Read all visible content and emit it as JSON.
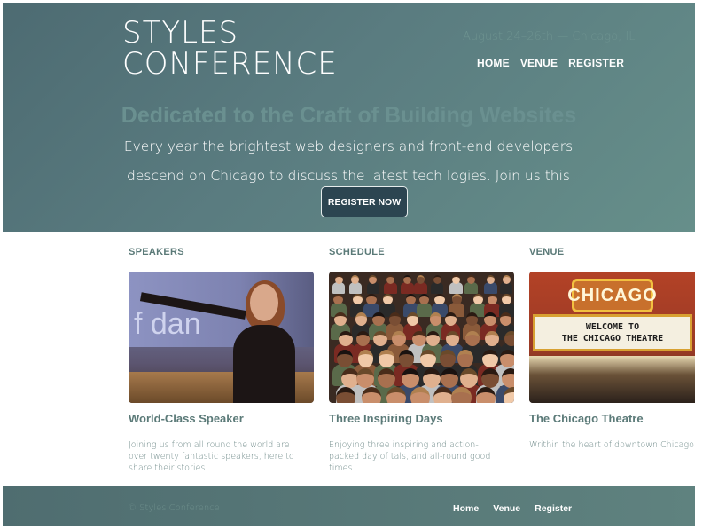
{
  "header": {
    "logo_line1": "STYLES",
    "logo_line2": "CONFERENCE",
    "tagline": "August 24–26th — Chicago, IL",
    "nav": [
      "HOME",
      "VENUE",
      "REGISTER"
    ]
  },
  "hero": {
    "headline": "Dedicated to the Craft of Building Websites",
    "lead": "Every year the brightest web designers and front-end developers descend on Chicago to discuss the latest tech logies. Join us this August!",
    "button": "REGISTER NOW"
  },
  "columns": [
    {
      "section": "SPEAKERS",
      "title": "World-Class Speaker",
      "text": "Joining us from all round the world are over twenty fantastic speakers, here to share their stories.",
      "image_text": "f dan"
    },
    {
      "section": "SCHEDULE",
      "title": "Three Inspiring Days",
      "text": "Enjoying three inspiring and action-packed day of tals, and all-round good times."
    },
    {
      "section": "VENUE",
      "title": "The Chicago Theatre",
      "text": "Writhin the heart of downtown Chicago The Chicago Theatre will provide a beau conference venue.",
      "sign_text": "CHICAGO",
      "marquee_line1": "WELCOME TO",
      "marquee_line2": "THE CHICAGO THEATRE"
    }
  ],
  "footer": {
    "copyright": "© Styles Conference",
    "nav": [
      "Home",
      "Venue",
      "Register"
    ]
  }
}
